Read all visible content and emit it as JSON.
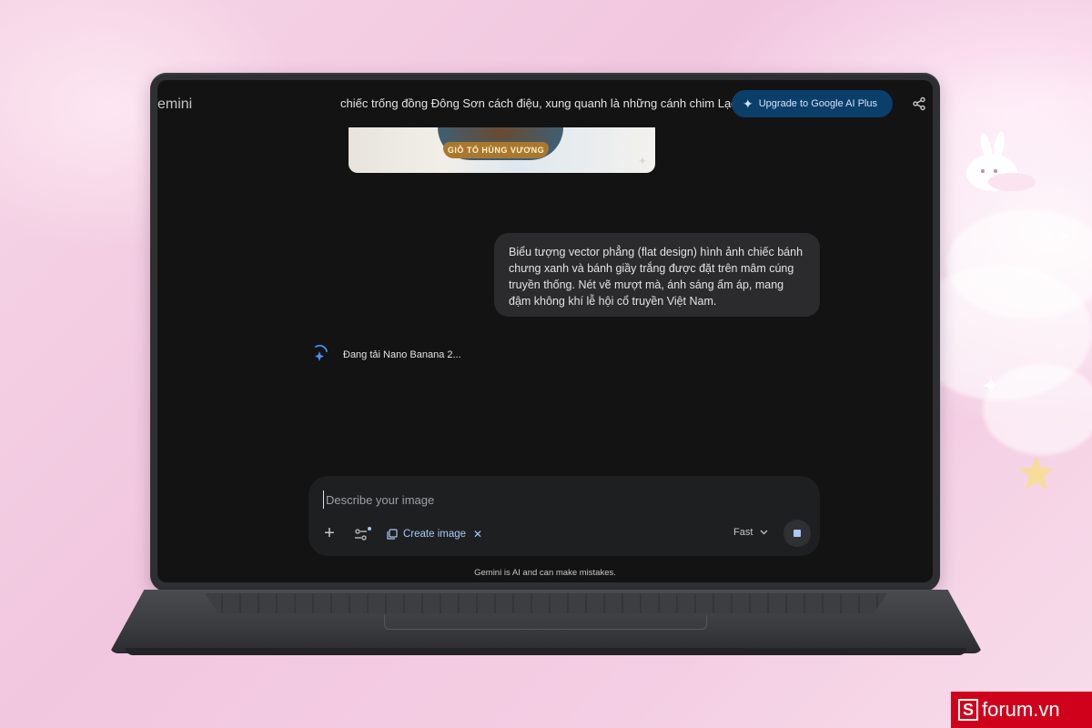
{
  "app": {
    "name": "emini",
    "conversation_title": "chiếc trống đồng Đông Sơn cách điệu, xung quanh là những cánh chim Lạc đa",
    "upgrade_label": "Upgrade to Google AI Plus"
  },
  "chat": {
    "image_banner_text": "GIỖ TỔ HÙNG VƯƠNG",
    "user_message": "Biểu tượng vector phẳng (flat design) hình ảnh chiếc bánh chưng xanh và bánh giầy trắng được đặt trên mâm cúng truyền thống. Nét vẽ mượt mà, ánh sáng ấm áp, mang đậm không khí lễ hội cổ truyền Việt Nam.",
    "loading_text": "Đang tải Nano Banana 2..."
  },
  "composer": {
    "placeholder": "Describe your image",
    "value": "",
    "create_chip_label": "Create image",
    "model_label": "Fast"
  },
  "footer": {
    "disclaimer": "Gemini is AI and can make mistakes."
  },
  "watermark": {
    "letter": "S",
    "text": "forum.vn"
  },
  "colors": {
    "screen_bg": "#131314",
    "bubble_bg": "#2b2b2e",
    "upgrade_bg": "#0b3f6a",
    "accent_blue": "#a8c7fa",
    "brand_red": "#d0021b"
  },
  "icons": [
    "sparkle-icon",
    "share-icon",
    "image-sparkle-icon",
    "loading-spinner-icon",
    "plus-icon",
    "tools-icon",
    "image-icon",
    "close-icon",
    "chevron-down-icon",
    "stop-icon"
  ]
}
